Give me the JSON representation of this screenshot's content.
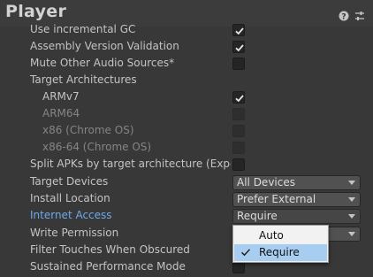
{
  "header": {
    "title": "Player"
  },
  "settings": [
    {
      "label": "Use incremental GC",
      "type": "checkbox",
      "checked": true
    },
    {
      "label": "Assembly Version Validation",
      "type": "checkbox",
      "checked": true
    },
    {
      "label": "Mute Other Audio Sources*",
      "type": "checkbox",
      "checked": false
    },
    {
      "label": "Target Architectures",
      "type": "header"
    },
    {
      "label": "ARMv7",
      "type": "checkbox",
      "checked": true
    },
    {
      "label": "ARM64",
      "type": "checkbox",
      "checked": false,
      "disabled": true
    },
    {
      "label": "x86 (Chrome OS)",
      "type": "checkbox",
      "checked": false,
      "disabled": true
    },
    {
      "label": "x86-64 (Chrome OS)",
      "type": "checkbox",
      "checked": false,
      "disabled": true
    },
    {
      "label": "Split APKs by target architecture (Experimental)",
      "type": "checkbox",
      "checked": false
    },
    {
      "label": "Target Devices",
      "type": "dropdown",
      "value": "All Devices"
    },
    {
      "label": "Install Location",
      "type": "dropdown",
      "value": "Prefer External"
    },
    {
      "label": "Internet Access",
      "type": "dropdown",
      "value": "Require"
    },
    {
      "label": "Write Permission",
      "type": "dropdown",
      "value": ""
    },
    {
      "label": "Filter Touches When Obscured",
      "type": "checkbox",
      "checked": false
    },
    {
      "label": "Sustained Performance Mode",
      "type": "checkbox",
      "checked": false
    }
  ],
  "popup": {
    "options": [
      "Auto",
      "Require"
    ],
    "selected": "Require"
  },
  "colors": {
    "background": "#383838",
    "link": "#6ea9e8",
    "selection": "#a7cdf0"
  }
}
